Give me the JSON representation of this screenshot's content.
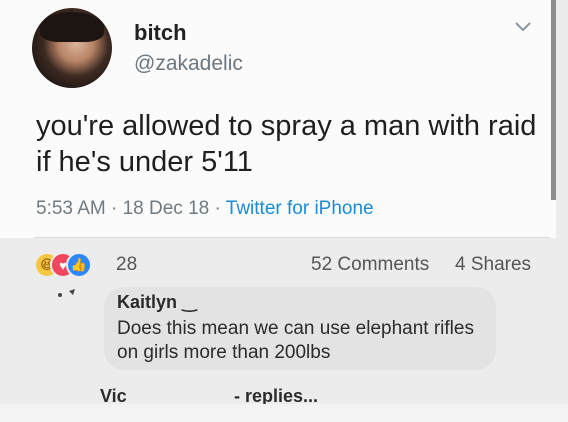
{
  "tweet": {
    "display_name": "bitch",
    "handle": "@zakadelic",
    "text": "you're allowed to spray a man with raid if he's under 5'11",
    "time": "5:53 AM",
    "separator1": " · ",
    "date": "18 Dec 18",
    "separator2": " · ",
    "source": "Twitter for iPhone",
    "menu_icon": "chevron-down-icon"
  },
  "post_stats": {
    "reaction_icons": [
      "haha-reaction-icon",
      "love-reaction-icon",
      "like-reaction-icon"
    ],
    "reaction_count": "28",
    "comments": "52 Comments",
    "shares": "4 Shares"
  },
  "comment": {
    "author": "Kaitlyn ‿",
    "text": "Does this mean we can use elephant rifles on girls more than 200lbs"
  },
  "reply_preview": {
    "name": "Vic",
    "replies_label": "- replies..."
  },
  "colors": {
    "card_background": "#fbfbfb",
    "link_blue": "#1b8bd6",
    "comment_bubble": "#e3e3e3",
    "muted_text": "#6f7a82"
  }
}
